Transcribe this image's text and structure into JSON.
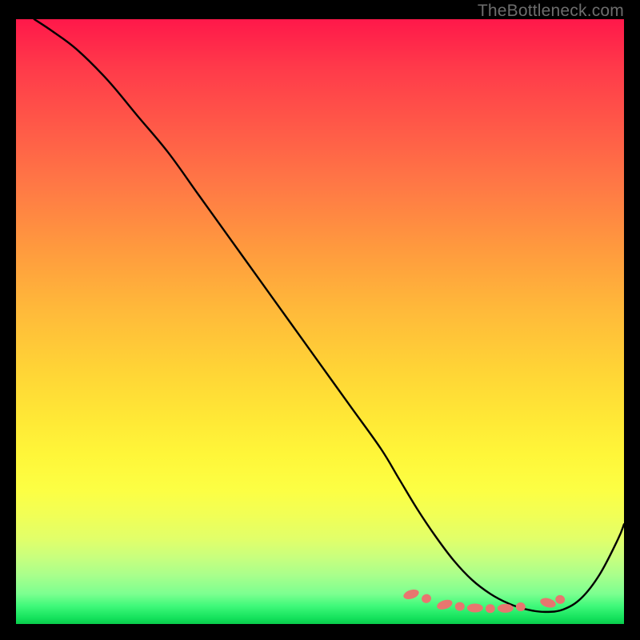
{
  "watermark": "TheBottleneck.com",
  "chart_data": {
    "type": "line",
    "title": "",
    "xlabel": "",
    "ylabel": "",
    "xlim": [
      0,
      100
    ],
    "ylim": [
      0,
      100
    ],
    "series": [
      {
        "name": "bottleneck-curve",
        "x": [
          3,
          6,
          10,
          15,
          20,
          25,
          30,
          35,
          40,
          45,
          50,
          55,
          60,
          63,
          66,
          69,
          72,
          75,
          78,
          81,
          84,
          87,
          90,
          93,
          96,
          99,
          100
        ],
        "y": [
          100,
          98,
          95,
          90,
          84,
          78,
          71,
          64,
          57,
          50,
          43,
          36,
          29,
          24,
          19,
          14.5,
          10.5,
          7.3,
          5,
          3.4,
          2.4,
          2,
          2.4,
          4.3,
          8.2,
          14,
          16.5
        ]
      }
    ],
    "markers": {
      "name": "highlighted-range",
      "points": [
        {
          "x": 65,
          "y": 4.9
        },
        {
          "x": 67.5,
          "y": 4.2
        },
        {
          "x": 70.5,
          "y": 3.2
        },
        {
          "x": 73,
          "y": 2.9
        },
        {
          "x": 75.5,
          "y": 2.65
        },
        {
          "x": 78,
          "y": 2.55
        },
        {
          "x": 80.5,
          "y": 2.6
        },
        {
          "x": 83,
          "y": 2.85
        },
        {
          "x": 87.5,
          "y": 3.5
        },
        {
          "x": 89.5,
          "y": 4.05
        }
      ]
    },
    "gradient_meaning": "red-to-green indicates bottleneck severity (top=high, bottom=low)"
  }
}
